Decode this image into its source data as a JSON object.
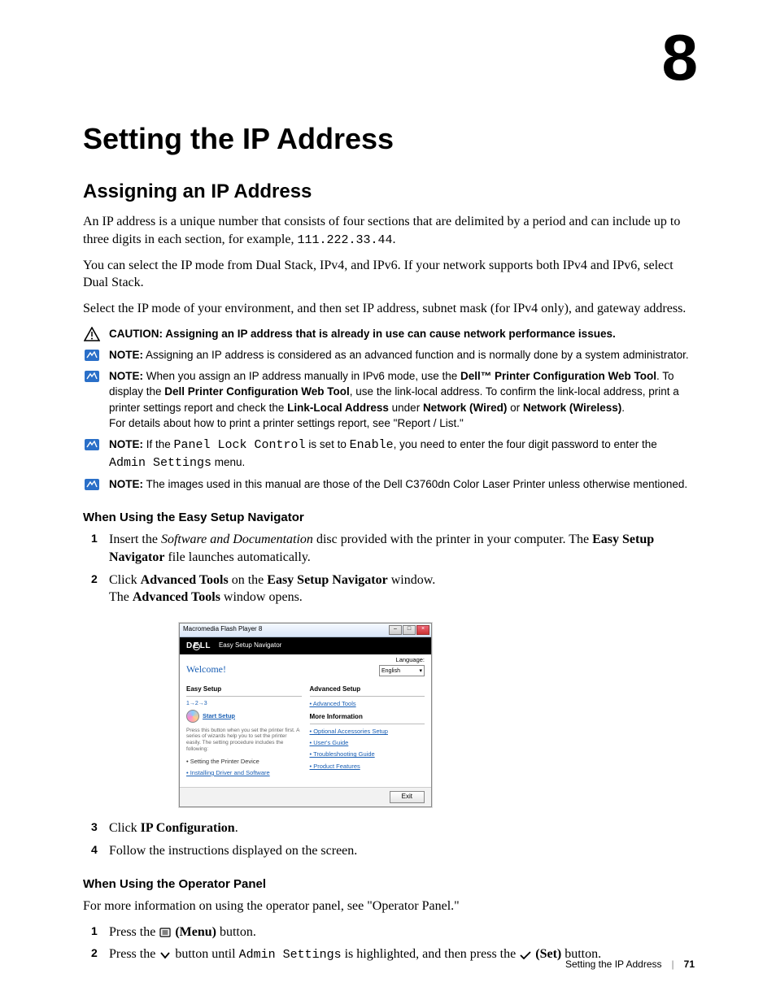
{
  "chapter_number": "8",
  "h1": "Setting the IP Address",
  "h2_1": "Assigning an IP Address",
  "para1_pre": "An IP address is a unique number that consists of four sections that are delimited by a period and can include up to three digits in each section, for example, ",
  "para1_mono": "111.222.33.44",
  "para1_post": ".",
  "para2": "You can select the IP mode from Dual Stack, IPv4, and IPv6. If your network supports both IPv4 and IPv6, select Dual Stack.",
  "para3": "Select the IP mode of your environment, and then set IP address, subnet mask (for IPv4 only), and gateway address.",
  "caution_label": "CAUTION:",
  "caution_text": " Assigning an IP address that is already in use can cause network performance issues.",
  "note_label": "NOTE:",
  "note1_text": " Assigning an IP address is considered as an advanced function and is normally done by a system administrator.",
  "note2_p1": " When you assign an IP address manually in IPv6 mode, use the ",
  "note2_b1": "Dell™ Printer Configuration Web Tool",
  "note2_p2": ". To display the ",
  "note2_b2": "Dell Printer Configuration Web Tool",
  "note2_p3": ", use the link-local address. To confirm the link-local address, print a printer settings report and check the ",
  "note2_b3": "Link-Local Address",
  "note2_p4": " under ",
  "note2_b4": "Network (Wired)",
  "note2_p5": " or ",
  "note2_b5": "Network (Wireless)",
  "note2_p6": ".",
  "note2_line2": "For details about how to print a printer settings report, see \"Report / List.\"",
  "note3_p1": " If the ",
  "note3_m1": "Panel Lock Control",
  "note3_p2": " is set to ",
  "note3_m2": "Enable",
  "note3_p3": ", you need to enter the four digit password to enter the ",
  "note3_m3": "Admin Settings",
  "note3_p4": " menu.",
  "note4_text": " The images used in this manual are those of the Dell C3760dn Color Laser Printer unless otherwise mentioned.",
  "sec1_title": "When Using the Easy Setup Navigator",
  "s1_1_p1": "Insert the ",
  "s1_1_i": "Software and Documentation",
  "s1_1_p2": " disc provided with the printer in your computer. The ",
  "s1_1_b": "Easy Setup Navigator",
  "s1_1_p3": " file launches automatically.",
  "s1_2_p1": "Click ",
  "s1_2_b1": "Advanced Tools",
  "s1_2_p2": " on the ",
  "s1_2_b2": "Easy Setup Navigator",
  "s1_2_p3": " window.",
  "s1_2_line2_p1": "The ",
  "s1_2_line2_b": "Advanced Tools",
  "s1_2_line2_p2": " window opens.",
  "s1_3_p1": "Click ",
  "s1_3_b": "IP Configuration",
  "s1_3_p2": ".",
  "s1_4": "Follow the instructions displayed on the screen.",
  "sec2_title": "When Using the Operator Panel",
  "sec2_intro": "For more information on using the operator panel, see \"Operator Panel.\"",
  "s2_1_p1": "Press the ",
  "s2_1_b": "(Menu)",
  "s2_1_p2": " button.",
  "s2_2_p1": "Press the ",
  "s2_2_p2": " button until ",
  "s2_2_m": "Admin Settings",
  "s2_2_p3": " is highlighted, and then press the ",
  "s2_2_b": "(Set)",
  "s2_2_p4": " button.",
  "app": {
    "titlebar": "Macromedia Flash Player 8",
    "header_sub": "Easy Setup Navigator",
    "welcome": "Welcome!",
    "lang_label": "Language:",
    "lang_value": "English",
    "panel_easy": "Easy Setup",
    "steps123": "1→2→3",
    "start_setup": "Start Setup",
    "easy_desc": "Press this button when you set the printer first. A series of wizards help you to set the printer easily. The setting procedure includes the following:",
    "bullet1": "• Setting the Printer Device",
    "link_install": "• Installing Driver and Software",
    "panel_adv": "Advanced Setup",
    "link_adv": "• Advanced Tools",
    "panel_more": "More Information",
    "link_opt": "• Optional Accessories Setup",
    "link_ug": "• User's Guide",
    "link_trb": "• Troubleshooting Guide",
    "link_pf": "• Product Features",
    "exit": "Exit"
  },
  "footer_title": "Setting the IP Address",
  "footer_page": "71"
}
